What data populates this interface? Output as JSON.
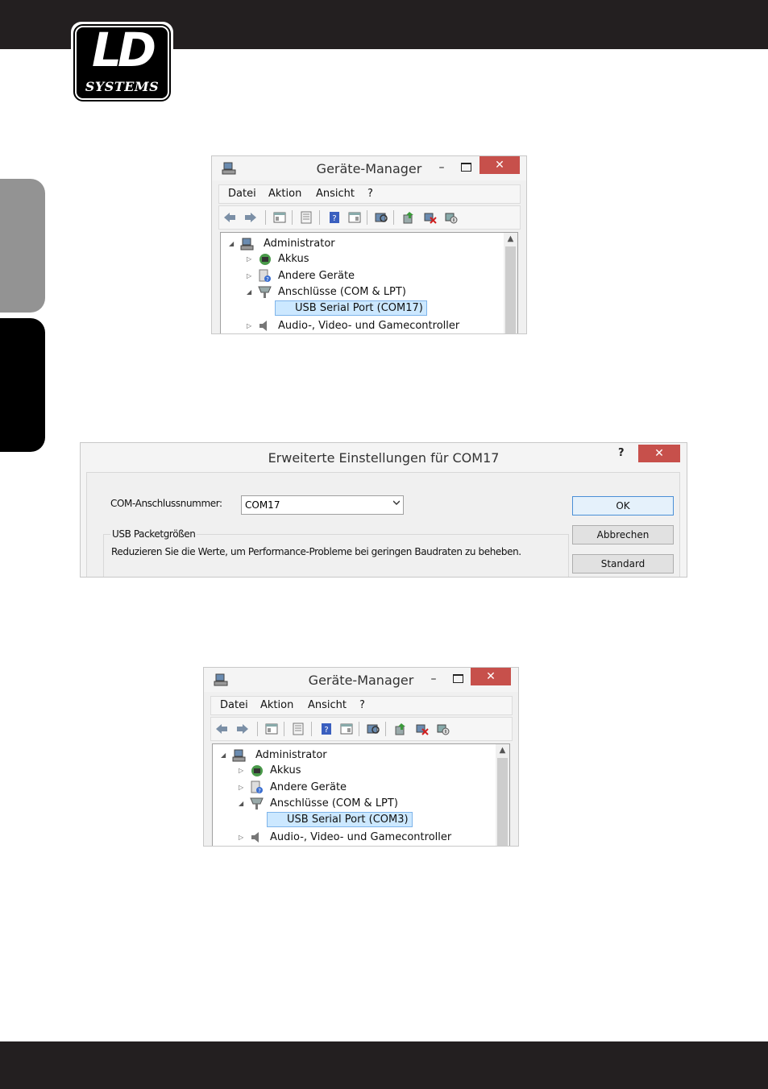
{
  "brand": {
    "logo_text": "LD",
    "logo_subtext": "SYSTEMS"
  },
  "window1": {
    "title": "Geräte-Manager",
    "minimize": "–",
    "close": "✕",
    "menu": [
      "Datei",
      "Aktion",
      "Ansicht",
      "?"
    ],
    "tree": {
      "root": "Administrator",
      "items": [
        "Akkus",
        "Andere Geräte",
        "Anschlüsse (COM & LPT)",
        "USB Serial Port (COM17)",
        "Audio-, Video- und Gamecontroller"
      ]
    }
  },
  "dialog": {
    "title": "Erweiterte Einstellungen für COM17",
    "help": "?",
    "close": "✕",
    "port_label": "COM-Anschlussnummer:",
    "port_value": "COM17",
    "usb_group_label": "USB Packetgrößen",
    "usb_description": "Reduzieren Sie die Werte, um Performance-Probleme bei geringen Baudraten zu beheben.",
    "ok": "OK",
    "cancel": "Abbrechen",
    "default": "Standard"
  },
  "window2": {
    "title": "Geräte-Manager",
    "minimize": "–",
    "close": "✕",
    "menu": [
      "Datei",
      "Aktion",
      "Ansicht",
      "?"
    ],
    "tree": {
      "root": "Administrator",
      "items": [
        "Akkus",
        "Andere Geräte",
        "Anschlüsse (COM & LPT)",
        "USB Serial Port (COM3)",
        "Audio-, Video- und Gamecontroller"
      ]
    }
  },
  "colors": {
    "bars": "#231f20",
    "close_button": "#c7504b",
    "selection": "#cce8ff",
    "side_tab_grey": "#939393"
  },
  "icons": [
    "back-arrow-icon",
    "forward-arrow-icon",
    "properties-icon",
    "help-icon",
    "scan-hardware-icon",
    "update-driver-icon",
    "uninstall-icon",
    "disable-icon",
    "computer-icon",
    "battery-icon",
    "unknown-device-icon",
    "port-connector-icon",
    "speaker-icon"
  ]
}
